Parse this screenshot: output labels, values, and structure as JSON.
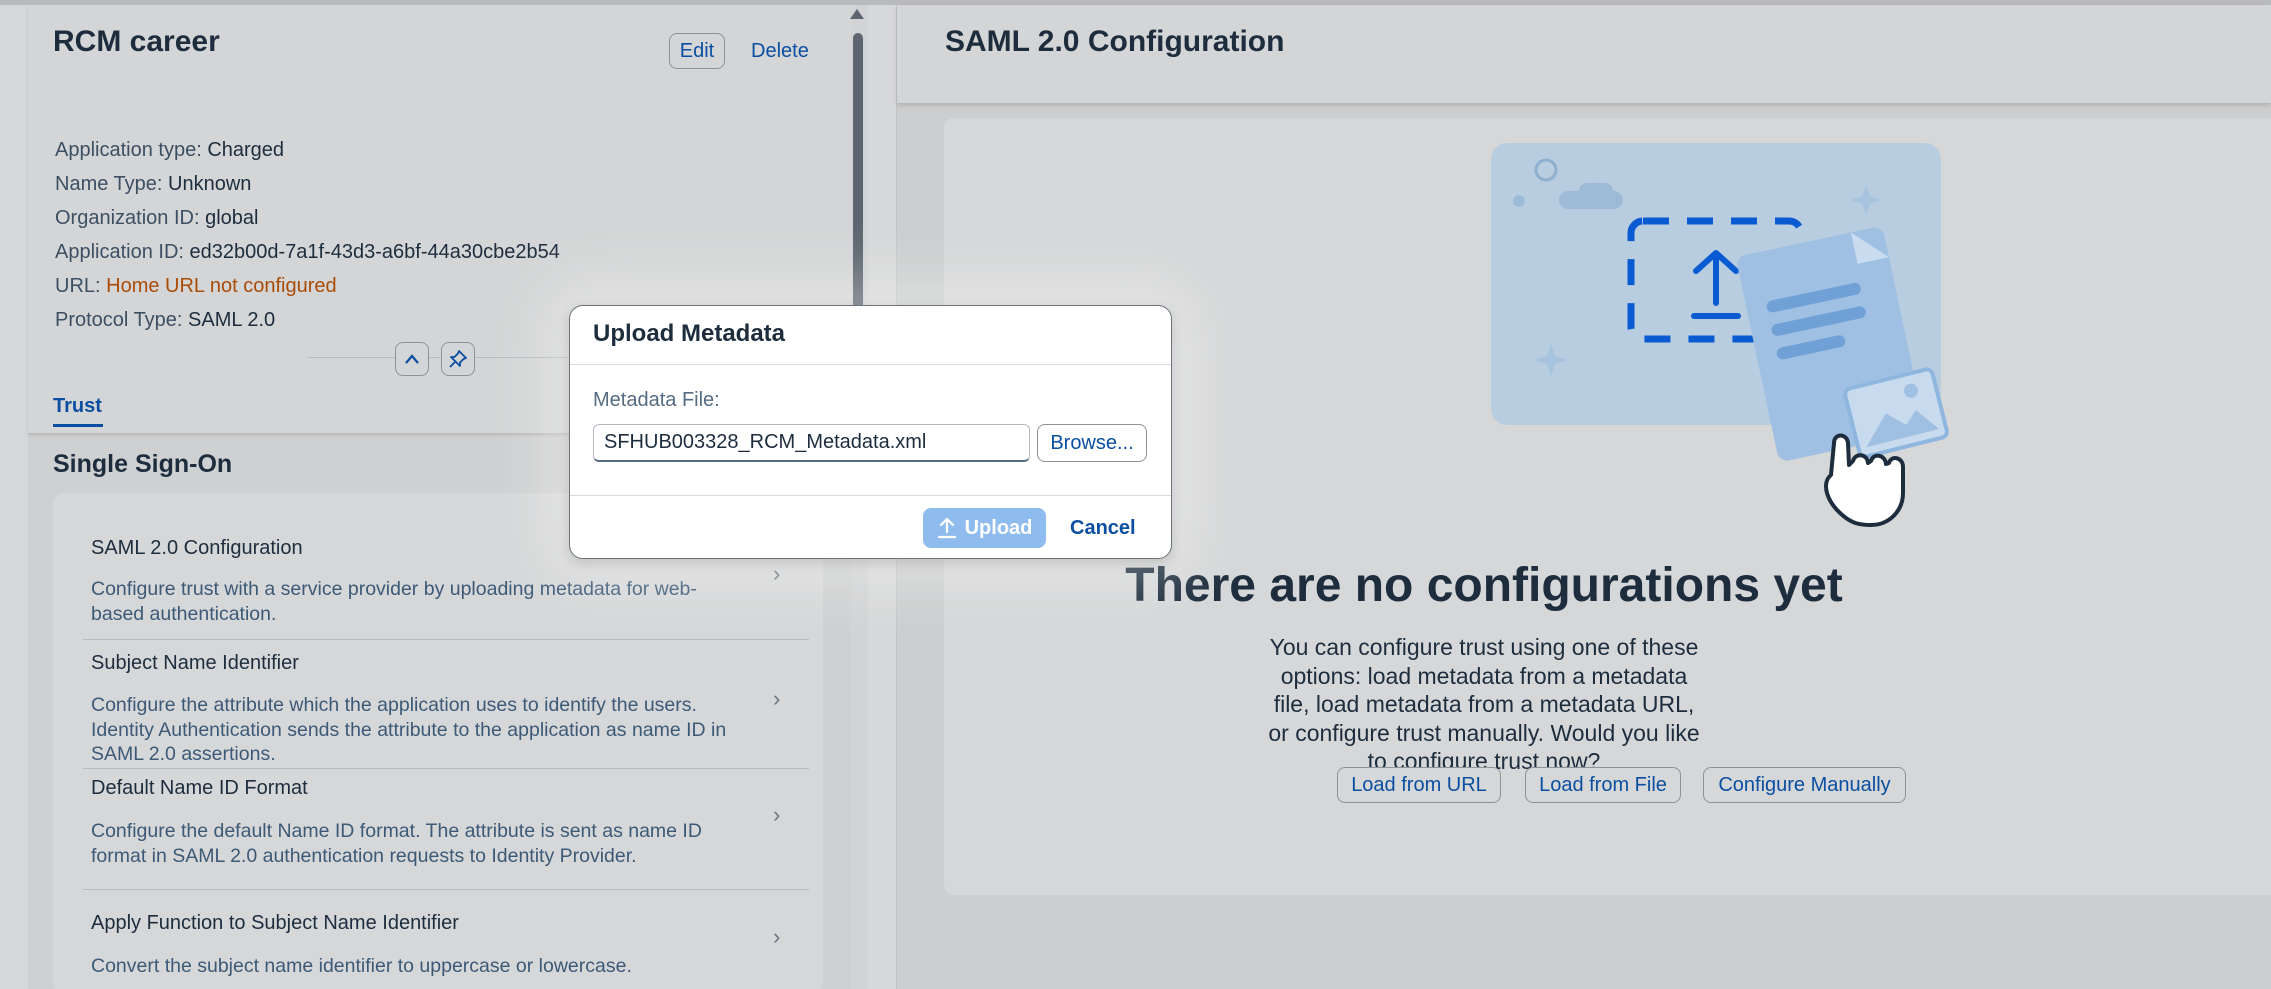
{
  "app": {
    "title": "RCM career",
    "edit_label": "Edit",
    "delete_label": "Delete",
    "attributes": [
      {
        "label": "Application type:",
        "value": "Charged"
      },
      {
        "label": "Name Type:",
        "value": "Unknown"
      },
      {
        "label": "Organization ID:",
        "value": "global"
      },
      {
        "label": "Application ID:",
        "value": "ed32b00d-7a1f-43d3-a6bf-44a30cbe2b54"
      },
      {
        "label": "URL:",
        "value": "Home URL not configured",
        "status": "warning"
      },
      {
        "label": "Protocol Type:",
        "value": "SAML 2.0"
      }
    ],
    "tab_trust": "Trust",
    "icons": {
      "collapse": "chevron-up-icon",
      "pin": "pin-icon"
    }
  },
  "sso": {
    "heading": "Single Sign-On",
    "items": [
      {
        "title": "SAML 2.0 Configuration",
        "description": "Configure trust with a service provider by uploading metadata for web-based authentication."
      },
      {
        "title": "Subject Name Identifier",
        "description": "Configure the attribute which the application uses to identify the users. Identity Authentication sends the attribute to the application as name ID in SAML 2.0 assertions."
      },
      {
        "title": "Default Name ID Format",
        "description": "Configure the default Name ID format. The attribute is sent as name ID format in SAML 2.0 authentication requests to Identity Provider."
      },
      {
        "title": "Apply Function to Subject Name Identifier",
        "description": "Convert the subject name identifier to uppercase or lowercase."
      }
    ]
  },
  "detail": {
    "title": "SAML 2.0 Configuration",
    "empty_title": "There are no configurations yet",
    "empty_description": "You can configure trust using one of these options: load metadata from a metadata file, load metadata from a metadata URL, or configure trust manually. Would you like to configure trust now?",
    "buttons": {
      "load_url": "Load from URL",
      "load_file": "Load from File",
      "configure_manually": "Configure Manually"
    }
  },
  "dialog": {
    "title": "Upload Metadata",
    "field_label": "Metadata File:",
    "file_value": "SFHUB003328_RCM_Metadata.xml",
    "browse_label": "Browse...",
    "upload_label": "Upload",
    "cancel_label": "Cancel"
  },
  "colors": {
    "accent": "#0a4fa1",
    "warning": "#aa4c07",
    "upload_disabled": "#8ebcef"
  }
}
